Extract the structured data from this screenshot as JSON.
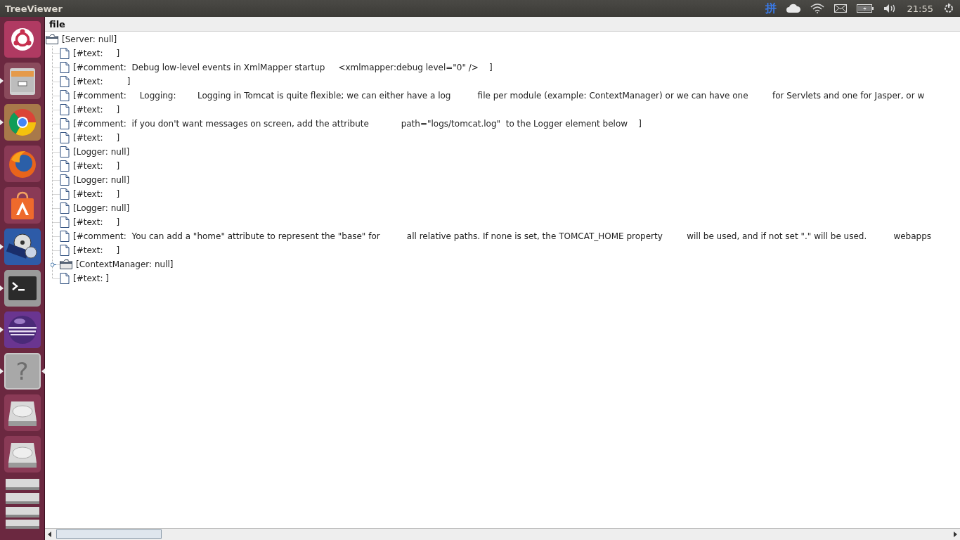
{
  "window": {
    "title": "TreeViewer"
  },
  "top_panel": {
    "input_method": "拼",
    "clock": "21:55"
  },
  "launcher": [
    {
      "kind": "ubuntu",
      "running": false,
      "focused": false
    },
    {
      "kind": "files",
      "running": true,
      "focused": false
    },
    {
      "kind": "chrome",
      "running": true,
      "focused": false
    },
    {
      "kind": "firefox",
      "running": false,
      "focused": false
    },
    {
      "kind": "software",
      "running": false,
      "focused": false
    },
    {
      "kind": "video",
      "running": true,
      "focused": false
    },
    {
      "kind": "terminal",
      "running": true,
      "focused": false
    },
    {
      "kind": "eclipse",
      "running": true,
      "focused": false
    },
    {
      "kind": "help",
      "running": true,
      "focused": true,
      "glyph": "?"
    },
    {
      "kind": "drive",
      "running": false,
      "focused": false
    },
    {
      "kind": "drive",
      "running": false,
      "focused": false
    },
    {
      "kind": "stack",
      "running": false,
      "focused": false
    }
  ],
  "menu": [
    "file"
  ],
  "tree": {
    "label": "[Server: null]",
    "expanded": true,
    "children": [
      {
        "label": "[#text:     ]"
      },
      {
        "label": "[#comment:  Debug low-level events in XmlMapper startup     <xmlmapper:debug level=\"0\" />    ]"
      },
      {
        "label": "[#text:         ]"
      },
      {
        "label": "[#comment:     Logging:        Logging in Tomcat is quite flexible; we can either have a log          file per module (example: ContextManager) or we can have one         for Servlets and one for Jasper, or w"
      },
      {
        "label": "[#text:     ]"
      },
      {
        "label": "[#comment:  if you don't want messages on screen, add the attribute            path=\"logs/tomcat.log\"  to the Logger element below    ]"
      },
      {
        "label": "[#text:     ]"
      },
      {
        "label": "[Logger: null]"
      },
      {
        "label": "[#text:     ]"
      },
      {
        "label": "[Logger: null]"
      },
      {
        "label": "[#text:     ]"
      },
      {
        "label": "[Logger: null]"
      },
      {
        "label": "[#text:     ]"
      },
      {
        "label": "[#comment:  You can add a \"home\" attribute to represent the \"base\" for          all relative paths. If none is set, the TOMCAT_HOME property         will be used, and if not set \".\" will be used.          webapps"
      },
      {
        "label": "[#text:     ]"
      },
      {
        "label": "[ContextManager: null]",
        "expanded": false
      },
      {
        "label": "[#text: ]"
      }
    ]
  }
}
